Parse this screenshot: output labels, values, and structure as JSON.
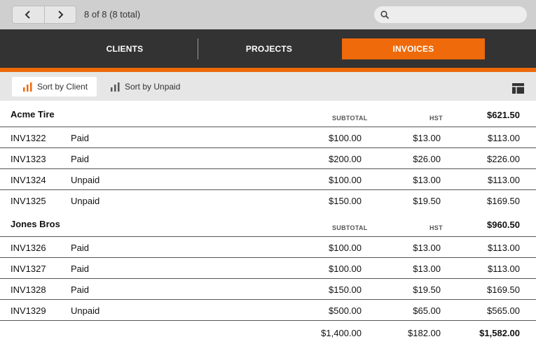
{
  "toolbar": {
    "pager_text": "8 of 8  (8 total)",
    "search": {
      "placeholder": "",
      "value": ""
    }
  },
  "tabs": [
    {
      "label": "CLIENTS",
      "active": false
    },
    {
      "label": "PROJECTS",
      "active": false
    },
    {
      "label": "INVOICES",
      "active": true
    }
  ],
  "sort": {
    "by_client": "Sort by Client",
    "by_unpaid": "Sort by Unpaid"
  },
  "colors": {
    "accent": "#ee6a0b",
    "tabbar": "#333333",
    "toolbar": "#cfcfcf"
  },
  "groups": [
    {
      "client": "Acme Tire",
      "subtotal_label": "SUBTOTAL",
      "hst_label": "HST",
      "total": "$621.50",
      "invoices": [
        {
          "id": "INV1322",
          "status": "Paid",
          "subtotal": "$100.00",
          "hst": "$13.00",
          "total": "$113.00"
        },
        {
          "id": "INV1323",
          "status": "Paid",
          "subtotal": "$200.00",
          "hst": "$26.00",
          "total": "$226.00"
        },
        {
          "id": "INV1324",
          "status": "Unpaid",
          "subtotal": "$100.00",
          "hst": "$13.00",
          "total": "$113.00"
        },
        {
          "id": "INV1325",
          "status": "Unpaid",
          "subtotal": "$150.00",
          "hst": "$19.50",
          "total": "$169.50"
        }
      ]
    },
    {
      "client": "Jones Bros",
      "subtotal_label": "SUBTOTAL",
      "hst_label": "HST",
      "total": "$960.50",
      "invoices": [
        {
          "id": "INV1326",
          "status": "Paid",
          "subtotal": "$100.00",
          "hst": "$13.00",
          "total": "$113.00"
        },
        {
          "id": "INV1327",
          "status": "Paid",
          "subtotal": "$100.00",
          "hst": "$13.00",
          "total": "$113.00"
        },
        {
          "id": "INV1328",
          "status": "Paid",
          "subtotal": "$150.00",
          "hst": "$19.50",
          "total": "$169.50"
        },
        {
          "id": "INV1329",
          "status": "Unpaid",
          "subtotal": "$500.00",
          "hst": "$65.00",
          "total": "$565.00"
        }
      ]
    }
  ],
  "grand_totals": {
    "subtotal": "$1,400.00",
    "hst": "$182.00",
    "total": "$1,582.00"
  }
}
